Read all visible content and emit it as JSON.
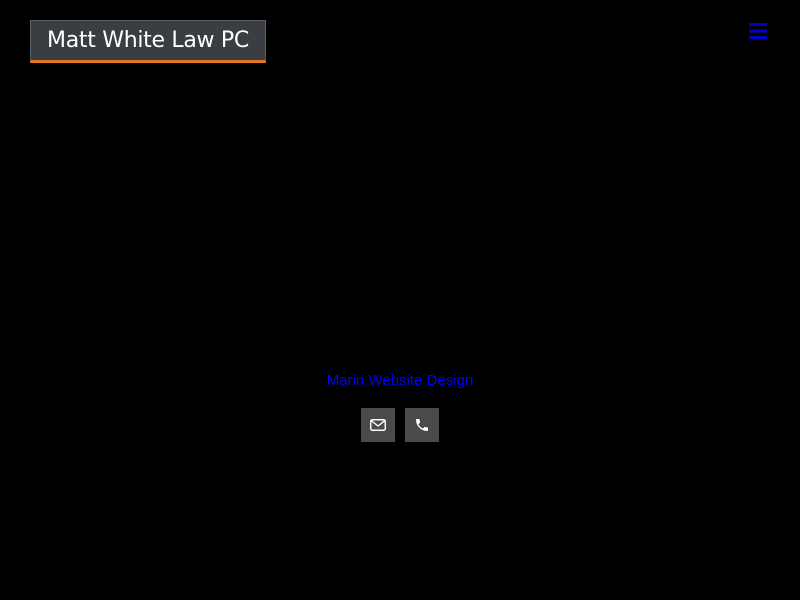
{
  "header": {
    "logo_text": "Matt White Law PC",
    "menu_icon": "hamburger-menu-icon"
  },
  "footer": {
    "credit_link": "Marin Website Design",
    "contact_buttons": [
      {
        "icon": "envelope-icon"
      },
      {
        "icon": "phone-icon"
      }
    ]
  },
  "colors": {
    "background": "#000000",
    "logo_background": "#3a3d42",
    "logo_accent": "#e87722",
    "link": "#0000ff",
    "button_background": "#4a4a4a"
  }
}
